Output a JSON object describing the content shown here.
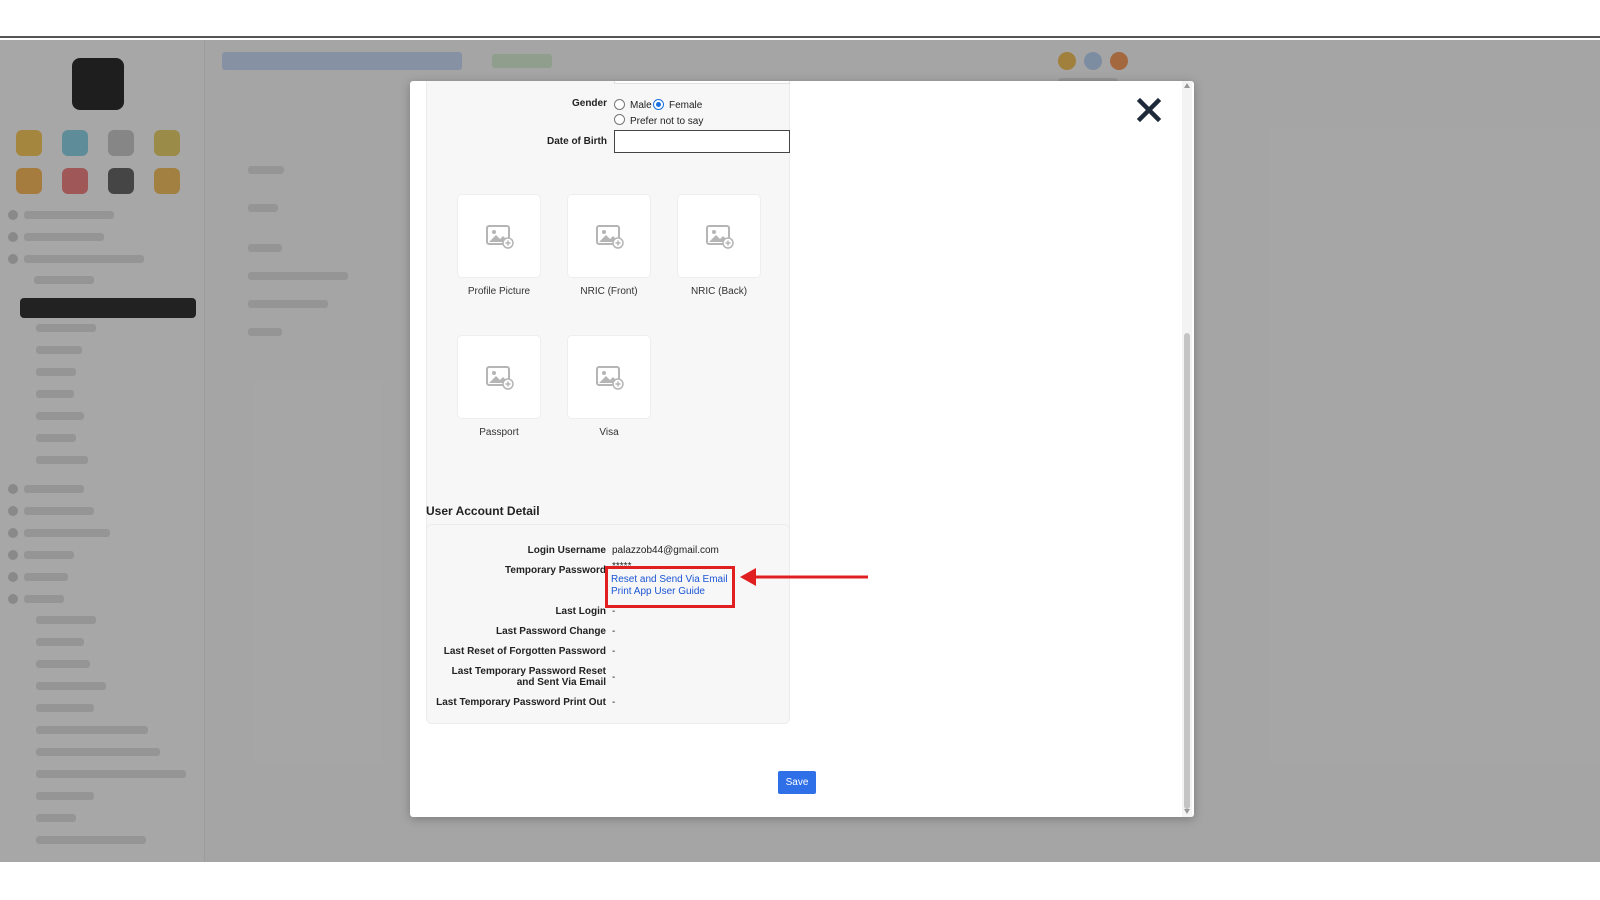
{
  "form": {
    "gender_label": "Gender",
    "gender_options": [
      "Male",
      "Female",
      "Prefer not to say"
    ],
    "gender_selected": "Female",
    "dob_label": "Date of Birth",
    "dob_value": ""
  },
  "documents": [
    {
      "label": "Profile Picture",
      "icon": "image-placeholder-icon"
    },
    {
      "label": "NRIC (Front)",
      "icon": "image-placeholder-icon"
    },
    {
      "label": "NRIC (Back)",
      "icon": "image-placeholder-icon"
    },
    {
      "label": "Passport",
      "icon": "image-placeholder-icon"
    },
    {
      "label": "Visa",
      "icon": "image-placeholder-icon"
    }
  ],
  "account": {
    "section_title": "User Account Detail",
    "login_username_label": "Login Username",
    "login_username_value": "palazzob44@gmail.com",
    "temp_password_label": "Temporary Password",
    "temp_password_value": "*****",
    "reset_link": "Reset and Send Via Email",
    "print_link": "Print App User Guide",
    "last_login_label": "Last Login",
    "last_login_value": "-",
    "last_password_change_label": "Last Password Change",
    "last_password_change_value": "-",
    "last_reset_forgotten_label": "Last Reset of Forgotten Password",
    "last_reset_forgotten_value": "-",
    "last_temp_reset_label_line1": "Last Temporary Password Reset",
    "last_temp_reset_label_line2": "and Sent Via Email",
    "last_temp_reset_value": "-",
    "last_temp_print_label": "Last Temporary Password Print Out",
    "last_temp_print_value": "-"
  },
  "buttons": {
    "save": "Save",
    "close_icon": "close-icon"
  },
  "annotation": {
    "highlight_color": "#e02020",
    "arrow_icon": "arrow-left-icon"
  },
  "colors": {
    "accent": "#2f6fe8",
    "link": "#1a55d6"
  }
}
